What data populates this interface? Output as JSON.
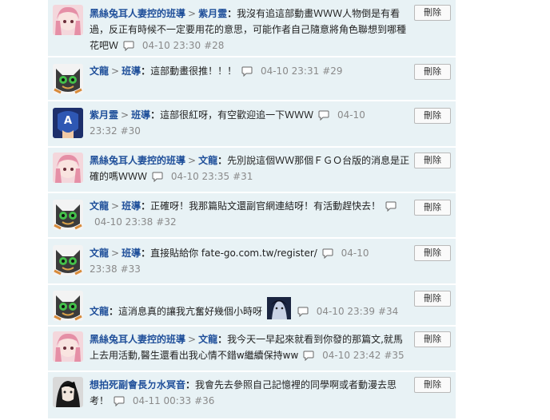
{
  "delete_label": "刪除",
  "comments": [
    {
      "user": "黑絲兔耳人妻控的班導",
      "target": "紫月霊",
      "content": "我沒有追這部動畫ＷＷＷ人物倒是有看過，反正有時候不一定要用花的意思，可能作者自己隨意將角色聯想到哪種花吧Ｗ",
      "time": "04-10 23:30",
      "num": "#28",
      "avatar": "pink-hair-avatar"
    },
    {
      "user": "文龍",
      "target": "班導",
      "content": "這部動畫很推！！！",
      "time": "04-10 23:31",
      "num": "#29",
      "avatar": "cat-mask-avatar"
    },
    {
      "user": "紫月霊",
      "target": "班導",
      "content": "這部很紅呀，有空歡迎追一下ＷＷＷ",
      "time": "04-10 23:32",
      "num": "#30",
      "avatar": "captain-mask-avatar"
    },
    {
      "user": "黑絲兔耳人妻控的班導",
      "target": "文龍",
      "content": "先別說這個ＷＷ那個ＦＧＯ台版的消息是正確的嗎ＷＷＷ",
      "time": "04-10 23:35",
      "num": "#31",
      "avatar": "pink-hair-avatar"
    },
    {
      "user": "文龍",
      "target": "班導",
      "content": "正確呀！我那篇貼文還副官網連結呀！有活動趕快去！",
      "time": "04-10 23:38",
      "num": "#32",
      "avatar": "cat-mask-avatar"
    },
    {
      "user": "文龍",
      "target": "班導",
      "content": "直接貼給你 fate-go.com.tw/register/",
      "time": "04-10 23:38",
      "num": "#33",
      "avatar": "cat-mask-avatar"
    },
    {
      "user": "文龍",
      "target": "",
      "content": "這消息真的讓我亢奮好幾個小時呀",
      "time": "04-10 23:39",
      "num": "#34",
      "avatar": "cat-mask-avatar"
    },
    {
      "user": "黑絲兔耳人妻控的班導",
      "target": "文龍",
      "content": "我今天一早起來就看到你發的那篇文,就馬上去用活動,醫生還看出我心情不錯w繼續保持ww",
      "time": "04-10 23:42",
      "num": "#35",
      "avatar": "pink-hair-avatar"
    },
    {
      "user": "想拍死副會長ㄉ水冥音",
      "target": "",
      "content": "我會先去參照自己記憶裡的同學啊或者動漫去思考！",
      "time": "04-11 00:33",
      "num": "#36",
      "avatar": "dark-hair-avatar"
    }
  ]
}
